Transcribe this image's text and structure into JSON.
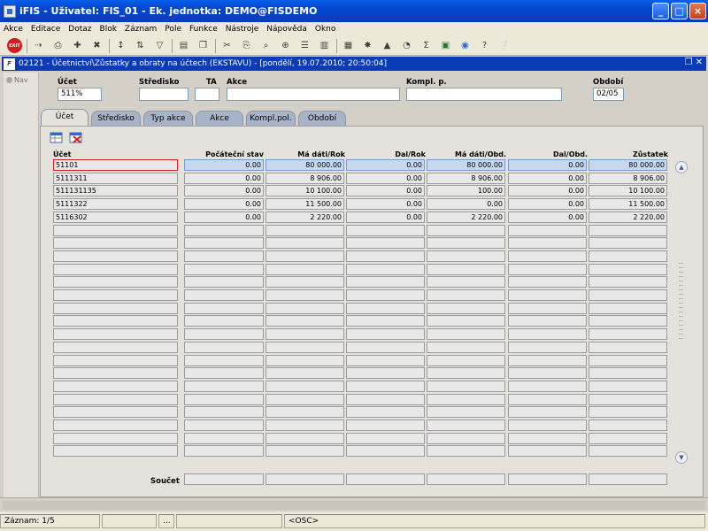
{
  "window": {
    "title": "iFIS - Uživatel: FIS_01 - Ek. jednotka: DEMO@FISDEMO",
    "minimize": "_",
    "maximize": "□",
    "close": "×"
  },
  "menu": [
    "Akce",
    "Editace",
    "Dotaz",
    "Blok",
    "Záznam",
    "Pole",
    "Funkce",
    "Nástroje",
    "Nápověda",
    "Okno"
  ],
  "toolbar": {
    "exit_label": "EXIT",
    "icons": [
      "exit-icon",
      "save-icon",
      "print-icon",
      "new-record-icon",
      "delete-record-icon",
      "sort-asc-icon",
      "sort-desc-icon",
      "filter-icon",
      "print-preview-icon",
      "copy-icon",
      "cut-icon",
      "paste-icon",
      "find-icon",
      "zoom-icon",
      "list-icon",
      "columns-icon",
      "calculator-icon",
      "settings-icon",
      "chart-icon",
      "clock-icon",
      "sum-icon",
      "excel-icon",
      "export-icon",
      "help-search-icon",
      "help-icon"
    ]
  },
  "form": {
    "title": "02121 - Účetnictví\\Zůstatky a obraty na účtech (EKSTAVU) - [pondělí, 19.07.2010; 20:50:04]",
    "nav_label": "Nav",
    "fields": {
      "ucet_label": "Účet",
      "ucet_value": "511%",
      "stredisko_label": "Středisko",
      "stredisko_value": "",
      "ta_label": "TA",
      "ta_value": "",
      "akce_label": "Akce",
      "akce_value": "",
      "kompl_label": "Kompl. p.",
      "kompl_value": "",
      "obdobi_label": "Období",
      "obdobi_value": "02/05"
    },
    "tabs": [
      "Účet",
      "Středisko",
      "Typ akce",
      "Akce",
      "Kompl.pol.",
      "Období"
    ],
    "active_tab": 0
  },
  "table": {
    "columns": [
      "Účet",
      "Počáteční stav",
      "Má dáti/Rok",
      "Dal/Rok",
      "Má dáti/Obd.",
      "Dal/Obd.",
      "Zůstatek"
    ],
    "rows": [
      [
        "51101",
        "0.00",
        "80 000.00",
        "0.00",
        "80 000.00",
        "0.00",
        "80 000.00"
      ],
      [
        "5111311",
        "0.00",
        "8 906.00",
        "0.00",
        "8 906.00",
        "0.00",
        "8 906.00"
      ],
      [
        "511131135",
        "0.00",
        "10 100.00",
        "0.00",
        "100.00",
        "0.00",
        "10 100.00"
      ],
      [
        "5111322",
        "0.00",
        "11 500.00",
        "0.00",
        "0.00",
        "0.00",
        "11 500.00"
      ],
      [
        "5116302",
        "0.00",
        "2 220.00",
        "0.00",
        "2 220.00",
        "0.00",
        "2 220.00"
      ]
    ],
    "empty_rows": 18,
    "sum_label": "Součet"
  },
  "status": {
    "record": "Záznam: 1/5",
    "segment2": "",
    "segment3": "...",
    "segment4": "",
    "mode": "<OSC>"
  }
}
